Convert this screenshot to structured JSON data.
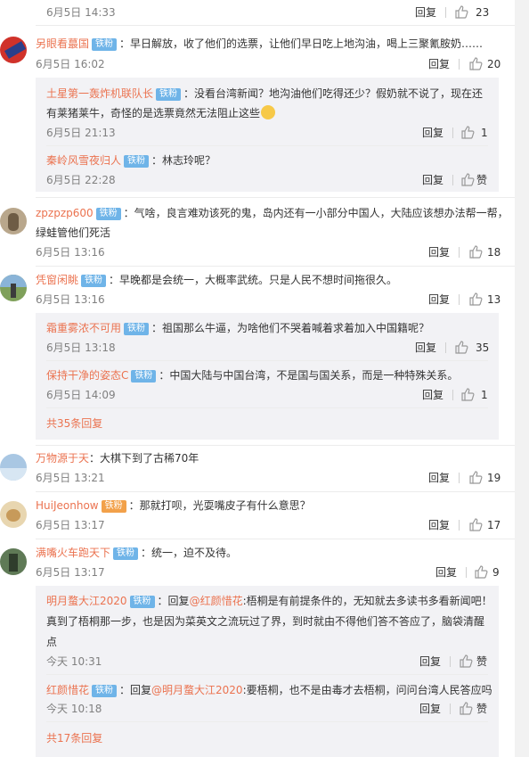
{
  "badge": "铁粉",
  "reply_label": "回复",
  "like_word": "赞",
  "colors": {
    "name": "#eb7350",
    "badge": "#6fb4e8",
    "time": "#808080",
    "reply_bg": "#f2f2f5"
  },
  "comments": [
    {
      "time": "6月5日 14:33",
      "likes": "23"
    },
    {
      "user": "另眼看蕞国",
      "text": "：早日解放，收了他们的选票，让他们早日吃上地沟油，喝上三聚氰胺奶……",
      "time": "6月5日 16:02",
      "likes": "20",
      "replies": [
        {
          "user": "土星第一轰炸机联队长",
          "text1": "：没看台湾新闻？地沟油他们吃得还少？假奶就不说了，现在还",
          "text2": "有莱猪莱牛，奇怪的是选票竟然无法阻止这些",
          "emoji": "emoji-face-icon",
          "time": "6月5日 21:13",
          "likes": "1"
        },
        {
          "user": "秦岭风雪夜归人",
          "text": "：林志玲呢？",
          "time": "6月5日 22:28",
          "likes": "赞"
        }
      ]
    },
    {
      "user": "zpzpzp600",
      "text1": "：气啥，良言难劝该死的鬼，岛内还有一小部分中国人，大陆应该想办法帮一帮，",
      "text2": "绿蛙管他们死活",
      "time": "6月5日 13:16",
      "likes": "18"
    },
    {
      "user": "凭窗闲眺",
      "text": "：早晚都是会统一，大概率武统。只是人民不想时间拖很久。",
      "time": "6月5日 13:16",
      "likes": "13",
      "replies": [
        {
          "user": "霜重雾浓不可用",
          "text": "：祖国那么牛逼，为啥他们不哭着喊着求着加入中国籍呢？",
          "time": "6月5日 13:18",
          "likes": "35"
        },
        {
          "user": "保持干净的姿态C",
          "text": "：中国大陆与中国台湾，不是国与国关系，而是一种特殊关系。",
          "time": "6月5日 14:09",
          "likes": "1"
        }
      ],
      "more": "共35条回复"
    },
    {
      "user": "万物源于天",
      "text": "：大棋下到了古稀70年",
      "time": "6月5日 13:21",
      "likes": "19"
    },
    {
      "user": "HuiJeonhow",
      "text": "：那就打呗，光耍嘴皮子有什么意思？",
      "time": "6月5日 13:17",
      "likes": "17"
    },
    {
      "user": "满嘴火车跑天下",
      "text": "：统一，迫不及待。",
      "time": "6月5日 13:17",
      "likes": "9",
      "replies": [
        {
          "user": "明月蝥大江2020",
          "reply_prefix": "：回复",
          "at": "@红颜惜花",
          "text1": ":梧桐是有前提条件的，无知就去多读书多看新闻吧！",
          "text2": "真到了梧桐那一步，也是因为菜英文之流玩过了界，到时就由不得他们答不答应了，脑袋清醒",
          "text3": "点",
          "time": "今天 10:31",
          "likes": "赞"
        },
        {
          "user": "红颜惜花",
          "reply_prefix": "：回复",
          "at": "@明月蝥大江2020",
          "text": ":要梧桐，也不是由毒才去梧桐，问问台湾人民答应吗",
          "time": "今天 10:18",
          "likes": "赞"
        }
      ],
      "more": "共17条回复"
    }
  ]
}
